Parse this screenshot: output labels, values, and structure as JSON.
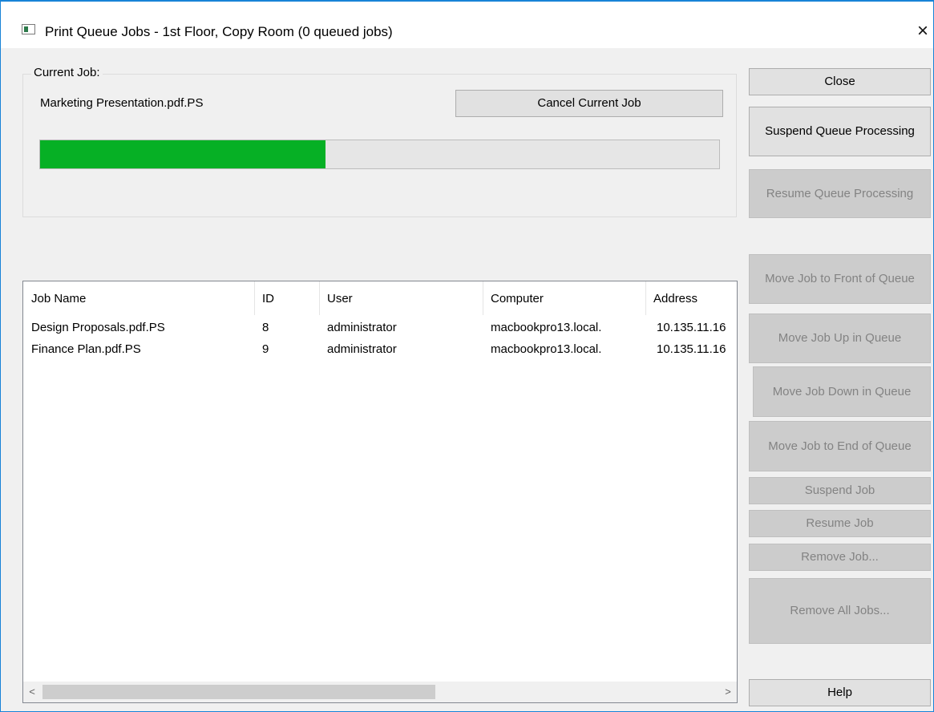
{
  "window": {
    "title": "Print Queue Jobs - 1st Floor, Copy Room (0 queued jobs)",
    "close_glyph": "×",
    "icon": "window-app-icon"
  },
  "current_job": {
    "group_label": "Current Job:",
    "file_name": "Marketing Presentation.pdf.PS",
    "cancel_label": "Cancel Current Job",
    "progress_fraction": 0.42,
    "progress_color": "#06b025"
  },
  "job_list": {
    "columns": [
      "Job Name",
      "ID",
      "User",
      "Computer",
      "Address"
    ],
    "rows": [
      [
        "Design Proposals.pdf.PS",
        "8",
        "administrator",
        "macbookpro13.local.",
        "10.135.11.16"
      ],
      [
        "Finance Plan.pdf.PS",
        "9",
        "administrator",
        "macbookpro13.local.",
        "10.135.11.16"
      ]
    ],
    "scroll_left": "<",
    "scroll_right": ">"
  },
  "buttons": {
    "close": "Close",
    "suspend_queue": "Suspend Queue  Processing",
    "resume_queue": "Resume Queue Processing",
    "move_front": "Move Job to Front of Queue",
    "move_up": "Move Job Up in Queue",
    "move_down": "Move Job Down in Queue",
    "move_end": "Move Job to End of Queue",
    "suspend_job": "Suspend Job",
    "resume_job": "Resume Job",
    "remove_job": "Remove Job...",
    "remove_all": "Remove All Jobs...",
    "help": "Help"
  }
}
